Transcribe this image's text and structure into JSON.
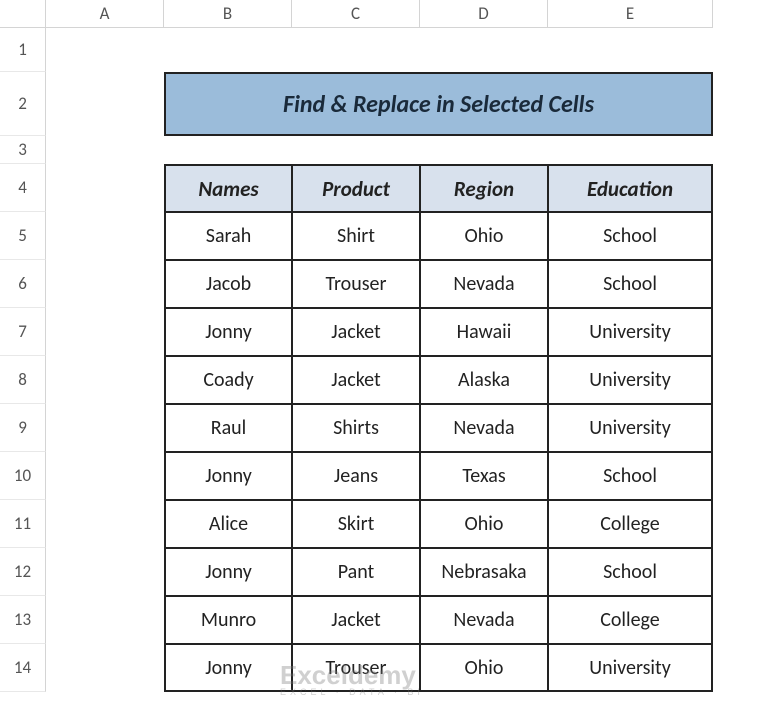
{
  "columns": [
    "A",
    "B",
    "C",
    "D",
    "E"
  ],
  "rows": [
    "1",
    "2",
    "3",
    "4",
    "5",
    "6",
    "7",
    "8",
    "9",
    "10",
    "11",
    "12",
    "13",
    "14"
  ],
  "title": "Find & Replace in Selected Cells",
  "headers": [
    "Names",
    "Product",
    "Region",
    "Education"
  ],
  "data": [
    [
      "Sarah",
      "Shirt",
      "Ohio",
      "School"
    ],
    [
      "Jacob",
      "Trouser",
      "Nevada",
      "School"
    ],
    [
      "Jonny",
      "Jacket",
      "Hawaii",
      "University"
    ],
    [
      "Coady",
      "Jacket",
      "Alaska",
      "University"
    ],
    [
      "Raul",
      "Shirts",
      "Nevada",
      "University"
    ],
    [
      "Jonny",
      "Jeans",
      "Texas",
      "School"
    ],
    [
      "Alice",
      "Skirt",
      "Ohio",
      "College"
    ],
    [
      "Jonny",
      "Pant",
      "Nebrasaka",
      "School"
    ],
    [
      "Munro",
      "Jacket",
      "Nevada",
      "College"
    ],
    [
      "Jonny",
      "Trouser",
      "Ohio",
      "University"
    ]
  ],
  "watermark": {
    "brand": "Exceldemy",
    "tagline": "EXCEL · DATA · BI"
  },
  "chart_data": {
    "type": "table",
    "title": "Find & Replace in Selected Cells",
    "columns": [
      "Names",
      "Product",
      "Region",
      "Education"
    ],
    "rows": [
      {
        "Names": "Sarah",
        "Product": "Shirt",
        "Region": "Ohio",
        "Education": "School"
      },
      {
        "Names": "Jacob",
        "Product": "Trouser",
        "Region": "Nevada",
        "Education": "School"
      },
      {
        "Names": "Jonny",
        "Product": "Jacket",
        "Region": "Hawaii",
        "Education": "University"
      },
      {
        "Names": "Coady",
        "Product": "Jacket",
        "Region": "Alaska",
        "Education": "University"
      },
      {
        "Names": "Raul",
        "Product": "Shirts",
        "Region": "Nevada",
        "Education": "University"
      },
      {
        "Names": "Jonny",
        "Product": "Jeans",
        "Region": "Texas",
        "Education": "School"
      },
      {
        "Names": "Alice",
        "Product": "Skirt",
        "Region": "Ohio",
        "Education": "College"
      },
      {
        "Names": "Jonny",
        "Product": "Pant",
        "Region": "Nebrasaka",
        "Education": "School"
      },
      {
        "Names": "Munro",
        "Product": "Jacket",
        "Region": "Nevada",
        "Education": "College"
      },
      {
        "Names": "Jonny",
        "Product": "Trouser",
        "Region": "Ohio",
        "Education": "University"
      }
    ]
  }
}
